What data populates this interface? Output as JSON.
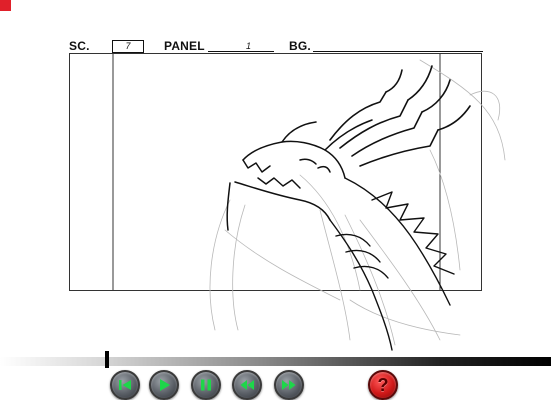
{
  "header": {
    "scene_label": "SC.",
    "scene_value": "7",
    "panel_label": "PANEL",
    "panel_value": "1",
    "bg_label": "BG.",
    "bg_value": ""
  },
  "timeline": {
    "position": 0.19
  },
  "controls": {
    "items": [
      {
        "name": "rewind-to-start-button",
        "icon": "skip-to-start-icon"
      },
      {
        "name": "play-button",
        "icon": "play-icon"
      },
      {
        "name": "pause-button",
        "icon": "pause-icon"
      },
      {
        "name": "previous-frame-button",
        "icon": "rewind-icon"
      },
      {
        "name": "next-frame-button",
        "icon": "fast-forward-icon"
      },
      {
        "name": "help-button",
        "icon": "question-mark-icon"
      }
    ],
    "help_label": "?"
  },
  "colors": {
    "accent_green": "#1ed64a",
    "help_red": "#d01818",
    "corner_mark": "#e0202a"
  }
}
